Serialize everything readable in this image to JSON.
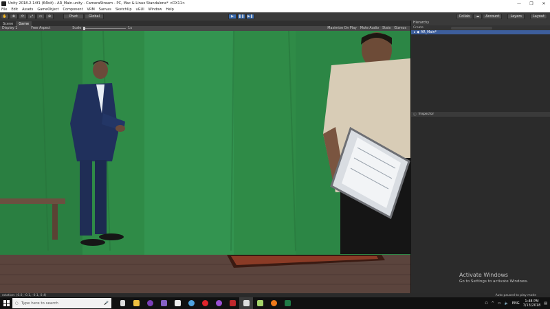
{
  "window": {
    "title": "Unity 2018.2.14f1 (64bit) - AR_Main.unity - CameraStream - PC, Mac & Linux Standalone* <DX11>"
  },
  "menu": [
    "File",
    "Edit",
    "Assets",
    "GameObject",
    "Component",
    "VRM",
    "Sanvas",
    "SketchUp",
    "uGUI",
    "Window",
    "Help"
  ],
  "toolbar": {
    "pivot": "Pivot",
    "global": "Global",
    "collab": "Collab",
    "account": "Account",
    "layers": "Layers",
    "layout": "Layout"
  },
  "tabs": {
    "scene": "Scene",
    "game": "Game"
  },
  "gamebar": {
    "display": "Display 1",
    "aspect": "Free Aspect",
    "scale_label": "Scale",
    "scale_value": "1x",
    "maximize": "Maximize On Play",
    "mute": "Mute Audio",
    "stats": "Stats",
    "gizmos": "Gizmos"
  },
  "hierarchy": {
    "title": "Hierarchy",
    "create": "Create",
    "item": "AR_Main*"
  },
  "inspector": {
    "title": "Inspector"
  },
  "watermark": {
    "title": "Activate Windows",
    "subtitle": "Go to Settings to activate Windows."
  },
  "status": {
    "left": "rotation: (0.0, -0.1, -0.1, 0.4)",
    "right": "Auto paused to play mode"
  },
  "taskbar": {
    "search_placeholder": "Type here to search",
    "lang": "ENG",
    "time": "1:48 PM",
    "date": "7/13/2018"
  }
}
